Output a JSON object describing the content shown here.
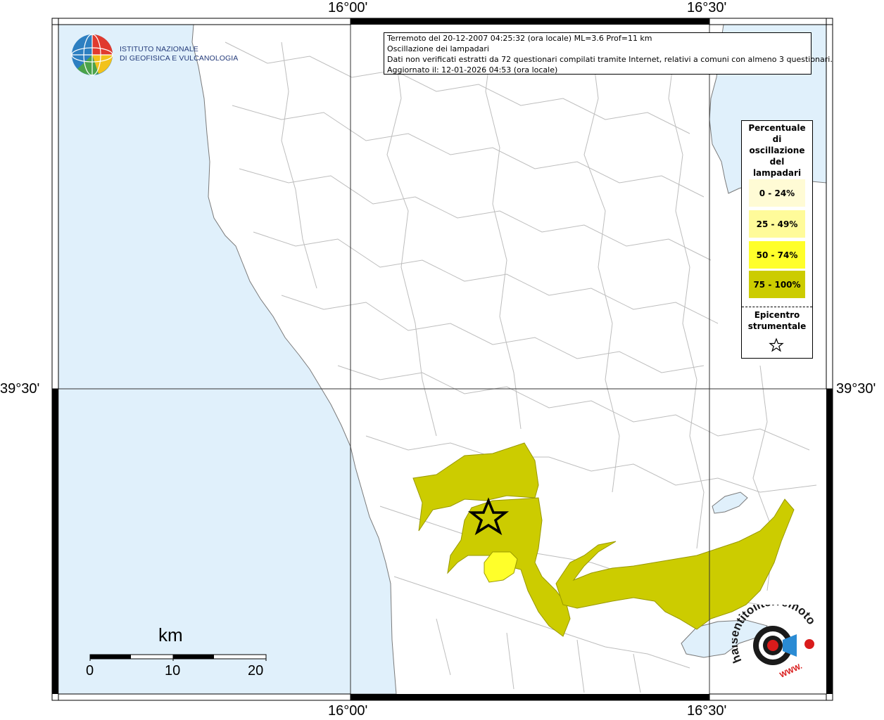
{
  "map": {
    "coords": {
      "lon_top_left": "16°00'",
      "lon_top_right": "16°30'",
      "lon_bottom_left": "16°00'",
      "lon_bottom_right": "16°30'",
      "lat_left": "39°30'",
      "lat_right": "39°30'"
    },
    "colors": {
      "sea": "#e0f0fb",
      "land": "#ffffff",
      "borders": "#b0b0b0",
      "class_0_24": "#fffbd5",
      "class_25_49": "#fffb9a",
      "class_50_74": "#ffff2a",
      "class_75_100": "#cccc00"
    }
  },
  "logo": {
    "line1": "ISTITUTO NAZIONALE",
    "line2": "DI GEOFISICA E VULCANOLOGIA"
  },
  "info": {
    "line1": "Terremoto del 20-12-2007 04:25:32 (ora locale) ML=3.6 Prof=11 km",
    "line2": "Oscillazione dei lampadari",
    "line3": "Dati non verificati estratti da 72 questionari compilati tramite Internet, relativi a comuni con almeno 3 questionari.",
    "line4": "Aggiornato il: 12-01-2026 04:53 (ora locale)"
  },
  "legend": {
    "title_lines": [
      "Percentuale",
      "di",
      "oscillazione",
      "del",
      "lampadari"
    ],
    "items": [
      {
        "label": "0 - 24%",
        "color": "#fffbd5"
      },
      {
        "label": "25 - 49%",
        "color": "#fffb9a"
      },
      {
        "label": "50 - 74%",
        "color": "#ffff2a"
      },
      {
        "label": "75 - 100%",
        "color": "#cccc00"
      }
    ],
    "epicenter_line1": "Epicentro",
    "epicenter_line2": "strumentale"
  },
  "scale": {
    "unit": "km",
    "ticks": [
      "0",
      "10",
      "20"
    ]
  },
  "hst_logo": {
    "text_arc": "haisentitoilterremoto.it",
    "text_www": "WWW."
  }
}
